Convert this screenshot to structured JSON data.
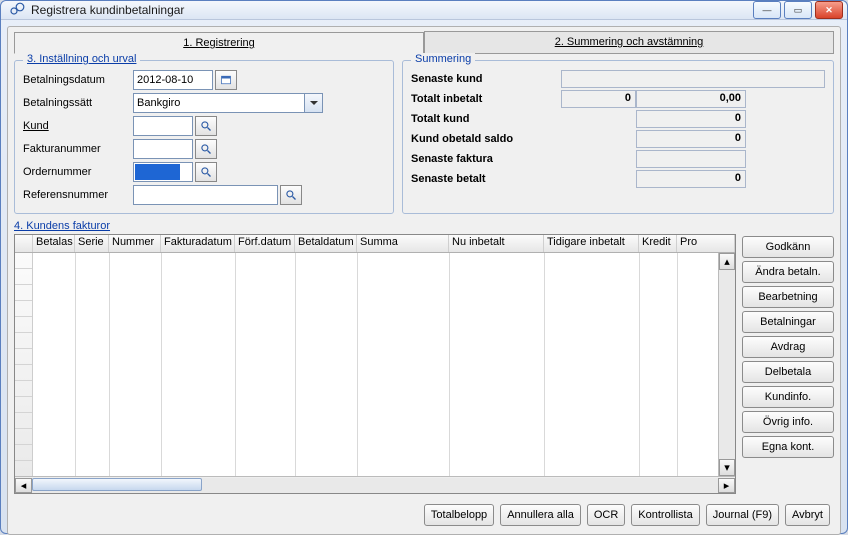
{
  "window": {
    "title": "Registrera kundinbetalningar"
  },
  "tabs": {
    "registering": "1. Registrering",
    "summering": "2. Summering och avstämning"
  },
  "section3": {
    "legend": "3. Inställning och urval",
    "betalningsdatum_label": "Betalningsdatum",
    "betalningsdatum_value": "2012-08-10",
    "betalningssatt_label": "Betalningssätt",
    "betalningssatt_value": "Bankgiro",
    "kund_label": "Kund",
    "kund_value": "",
    "fakturanummer_label": "Fakturanummer",
    "fakturanummer_value": "",
    "ordernummer_label": "Ordernummer",
    "ordernummer_value": "",
    "referensnummer_label": "Referensnummer",
    "referensnummer_value": ""
  },
  "summering": {
    "legend": "Summering",
    "senaste_kund_label": "Senaste kund",
    "senaste_kund_value": "",
    "totalt_inbetalt_label": "Totalt inbetalt",
    "totalt_inbetalt_count": "0",
    "totalt_inbetalt_amount": "0,00",
    "totalt_kund_label": "Totalt kund",
    "totalt_kund_value": "0",
    "kund_obetald_label": "Kund obetald saldo",
    "kund_obetald_value": "0",
    "senaste_faktura_label": "Senaste faktura",
    "senaste_faktura_value": "",
    "senaste_betalt_label": "Senaste betalt",
    "senaste_betalt_value": "0"
  },
  "section4": {
    "legend": "4. Kundens fakturor"
  },
  "grid": {
    "cols": {
      "betalas": "Betalas",
      "serie": "Serie",
      "nummer": "Nummer",
      "fakturadatum": "Fakturadatum",
      "forfdatum": "Förf.datum",
      "betaldatum": "Betaldatum",
      "summa": "Summa",
      "nu_inbetalt": "Nu inbetalt",
      "tidigare_inbetalt": "Tidigare inbetalt",
      "kredit": "Kredit",
      "pro": "Pro"
    }
  },
  "sidebuttons": {
    "godkann": "Godkänn",
    "andra_betaln": "Ändra betaln.",
    "bearbetning": "Bearbetning",
    "betalningar": "Betalningar",
    "avdrag": "Avdrag",
    "delbetala": "Delbetala",
    "kundinfo": "Kundinfo.",
    "ovrig_info": "Övrig info.",
    "egna_kont": "Egna kont."
  },
  "bottombuttons": {
    "totalbelopp": "Totalbelopp",
    "annullera_alla": "Annullera alla",
    "ocr": "OCR",
    "kontrollista": "Kontrollista",
    "journal": "Journal (F9)",
    "avbryt": "Avbryt"
  }
}
